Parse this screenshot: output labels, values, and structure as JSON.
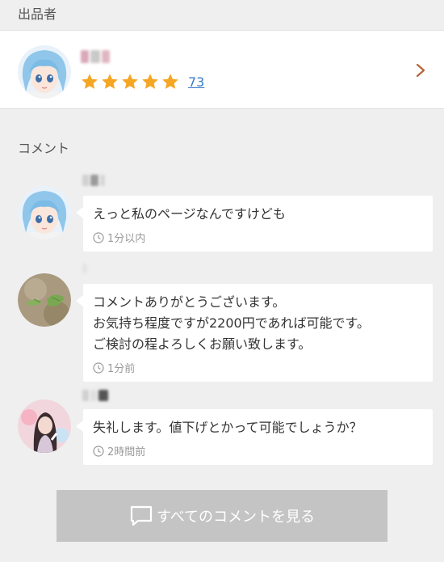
{
  "seller_section": {
    "label": "出品者",
    "rating_count": "73",
    "star_color": "#f5a623"
  },
  "comments_section": {
    "label": "コメント",
    "comments": [
      {
        "text": "えっと私のページなんですけども",
        "time": "1分以内"
      },
      {
        "text": "コメントありがとうございます。\nお気持ち程度ですが2200円であれば可能です。\nご検討の程よろしくお願い致します。",
        "time": "1分前"
      },
      {
        "text": "失礼します。値下げとかって可能でしょうか？",
        "time": "2時間前"
      }
    ]
  },
  "all_comments_button": {
    "label": "すべてのコメントを見る",
    "icon": "chat-bubble-icon"
  },
  "colors": {
    "link": "#3a7bc8",
    "star": "#f5a623",
    "button_bg": "#c4c4c4",
    "chevron": "#b5653a"
  }
}
